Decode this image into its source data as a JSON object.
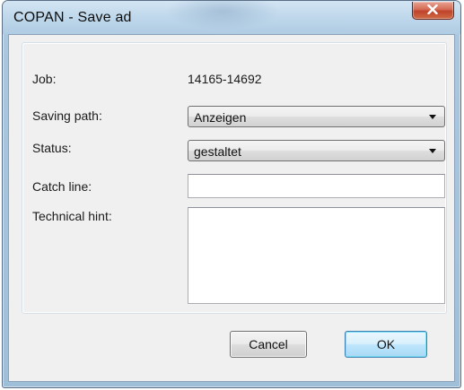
{
  "window": {
    "title": "COPAN - Save ad"
  },
  "title_bar": {
    "close_icon": "close-x-icon"
  },
  "form": {
    "job": {
      "label": "Job:",
      "value": "14165-14692"
    },
    "saving_path": {
      "label": "Saving path:",
      "selected": "Anzeigen"
    },
    "status": {
      "label": "Status:",
      "selected": "gestaltet"
    },
    "catch_line": {
      "label": "Catch line:",
      "value": ""
    },
    "technical_hint": {
      "label": "Technical hint:",
      "value": ""
    }
  },
  "buttons": {
    "cancel_label": "Cancel",
    "ok_label": "OK"
  },
  "colors": {
    "frame": "#a9c7df",
    "close_button": "#c0432a",
    "default_button_border": "#3c7fb1"
  }
}
